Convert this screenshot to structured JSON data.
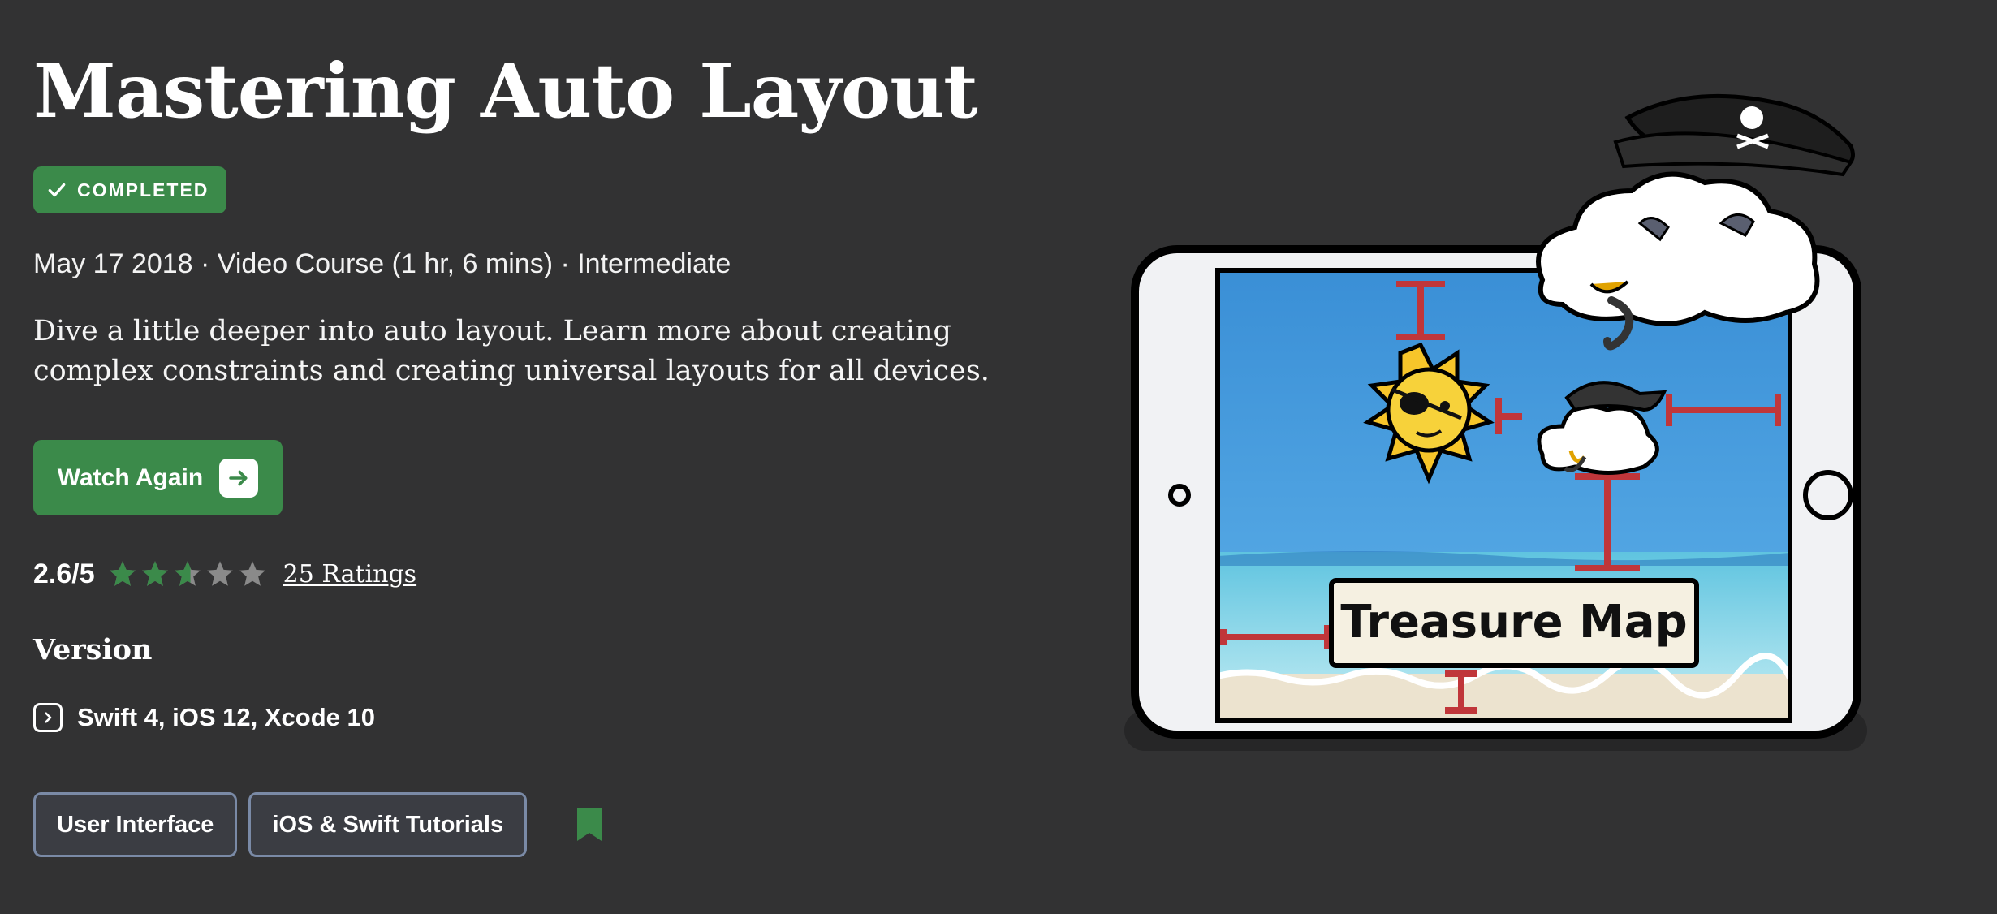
{
  "course": {
    "title": "Mastering Auto Layout",
    "status_badge": "COMPLETED",
    "meta": "May 17 2018 · Video Course (1 hr, 6 mins) · Intermediate",
    "description": "Dive a little deeper into auto layout. Learn more about creating complex constraints and creating universal layouts for all devices.",
    "action_button": "Watch Again",
    "rating": {
      "score_label": "2.6/5",
      "score": 2.6,
      "max": 5,
      "count_label": "25 Ratings"
    },
    "version_heading": "Version",
    "version": "Swift 4, iOS 12, Xcode 10",
    "tags": [
      "User Interface",
      "iOS & Swift Tutorials"
    ]
  },
  "illustration": {
    "sign_text": "Treasure Map"
  },
  "colors": {
    "background": "#323233",
    "accent_green": "#3b8a4a",
    "star_empty": "#8a8a8a",
    "tag_border": "#7a8aa6",
    "constraint_red": "#c0363a"
  },
  "icons": [
    "check-icon",
    "arrow-right-icon",
    "star-icon",
    "chevron-right-icon",
    "bookmark-icon"
  ]
}
